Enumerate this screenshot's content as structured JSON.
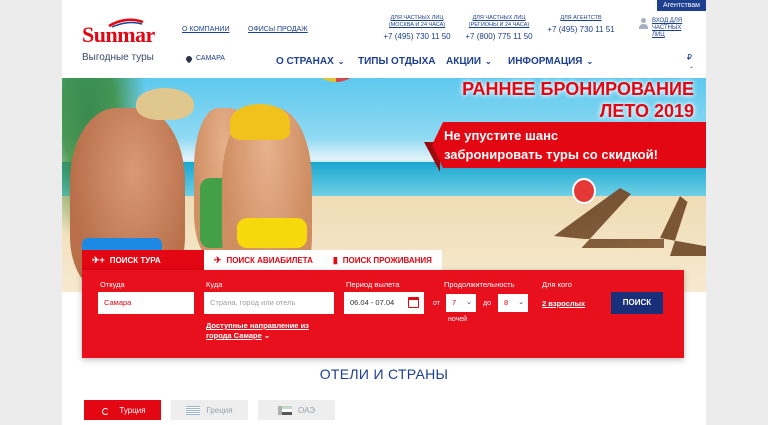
{
  "header": {
    "agent_button": "Агентствам",
    "logo_text": "Sunmar",
    "tagline": "Выгодные туры",
    "links": [
      "О КОМПАНИИ",
      "ОФИСЫ ПРОДАЖ"
    ],
    "phones": [
      {
        "note": "ДЛЯ ЧАСТНЫХ ЛИЦ (МОСКВА И 24 ЧАСА)",
        "number": "+7 (495) 730 11 50"
      },
      {
        "note": "ДЛЯ ЧАСТНЫХ ЛИЦ (РЕГИОНЫ И 24 ЧАСА)",
        "number": "+7 (800) 775 11 50"
      },
      {
        "note": "ДЛЯ АГЕНТСТВ",
        "number": "+7 (495) 730 11 51"
      }
    ],
    "login": "ВХОД ДЛЯ ЧАСТНЫХ ЛИЦ",
    "city": "САМАРА",
    "currency": "₽"
  },
  "nav": {
    "items": [
      "О СТРАНАХ",
      "ТИПЫ ОТДЫХА",
      "АКЦИИ",
      "ИНФОРМАЦИЯ"
    ]
  },
  "hero": {
    "title_line1": "РАННЕЕ БРОНИРОВАНИЕ",
    "title_line2": "ЛЕТО 2019",
    "sub_line1": "Не упустите шанс",
    "sub_line2": "забронировать туры со скидкой!"
  },
  "search": {
    "tabs": [
      "ПОИСК ТУРА",
      "ПОИСК АВИАБИЛЕТА",
      "ПОИСК ПРОЖИВАНИЯ"
    ],
    "from_label": "Откуда",
    "from_value": "Самара",
    "to_label": "Куда",
    "to_placeholder": "Страна, город или отель",
    "dest_hint": "Доступные направление из города Самаре",
    "period_label": "Период вылета",
    "period_value": "06.04 - 07.04",
    "duration_label": "Продолжительность",
    "from_word": "от",
    "to_word": "до",
    "nights_word": "ночей",
    "nights_from": "7",
    "nights_to": "8",
    "who_label": "Для кого",
    "who_value": "2 взрослых",
    "search_button": "ПОИСК"
  },
  "countries": {
    "title": "ОТЕЛИ И СТРАНЫ",
    "tabs": [
      "Турция",
      "Греция",
      "ОАЭ"
    ]
  },
  "colors": {
    "brand_red": "#e30613",
    "brand_blue": "#1d3f8f",
    "search_button": "#1a2f7a"
  },
  "icons": [
    "location-pin-icon",
    "chevron-down-icon",
    "user-icon",
    "plane-icon",
    "hotel-icon",
    "calendar-icon",
    "flag-turkey-icon",
    "flag-greece-icon",
    "flag-uae-icon"
  ]
}
